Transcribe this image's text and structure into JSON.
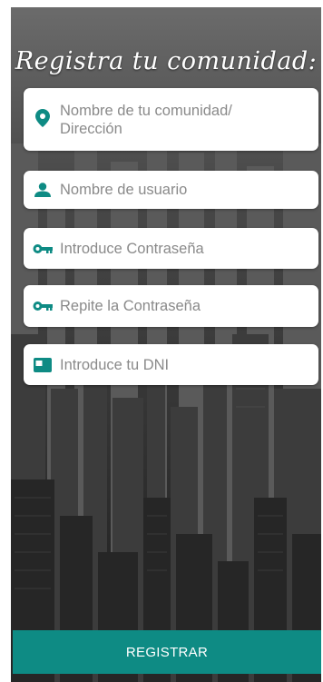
{
  "title": "Registra tu comunidad:",
  "accent_color": "#0e8b84",
  "fields": [
    {
      "placeholder": "Nombre de tu comunidad/\nDirección",
      "icon": "location-pin-icon"
    },
    {
      "placeholder": "Nombre de usuario",
      "icon": "person-icon"
    },
    {
      "placeholder": "Introduce Contraseña",
      "icon": "key-icon"
    },
    {
      "placeholder": "Repite la Contraseña",
      "icon": "key-icon"
    },
    {
      "placeholder": "Introduce tu DNI",
      "icon": "id-card-icon"
    }
  ],
  "register_button": "REGISTRAR"
}
